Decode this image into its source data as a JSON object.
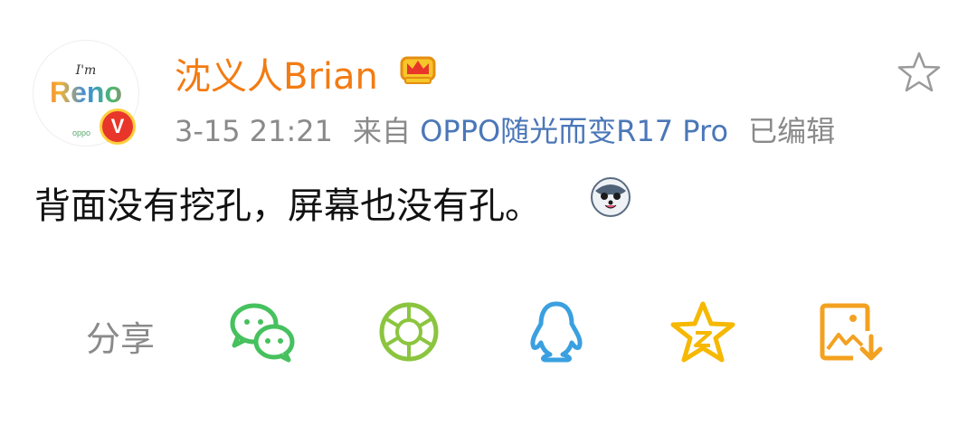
{
  "post": {
    "username": "沈义人Brian",
    "time": "3-15 21:21",
    "source_prefix": "来自",
    "source": "OPPO随光而变R17 Pro",
    "edited": "已编辑",
    "content": "背面没有挖孔，屏幕也没有孔。",
    "avatar_text_small": "I'm",
    "avatar_text_main": "Reno",
    "avatar_brand": "oppo",
    "verified_badge": "V"
  },
  "share": {
    "label": "分享",
    "targets": [
      {
        "name": "wechat",
        "icon": "wechat-icon",
        "color": "#46c15e"
      },
      {
        "name": "moments",
        "icon": "moments-aperture-icon",
        "color": "#8bc53f"
      },
      {
        "name": "qq",
        "icon": "qq-penguin-icon",
        "color": "#3aa0e0"
      },
      {
        "name": "qzone",
        "icon": "qzone-star-icon",
        "color": "#f6b800"
      },
      {
        "name": "save-image",
        "icon": "save-image-icon",
        "color": "#f3a120"
      }
    ]
  },
  "colors": {
    "username": "#f37b12",
    "source": "#4b77b8",
    "meta": "#8a8a8a",
    "text": "#111111"
  }
}
